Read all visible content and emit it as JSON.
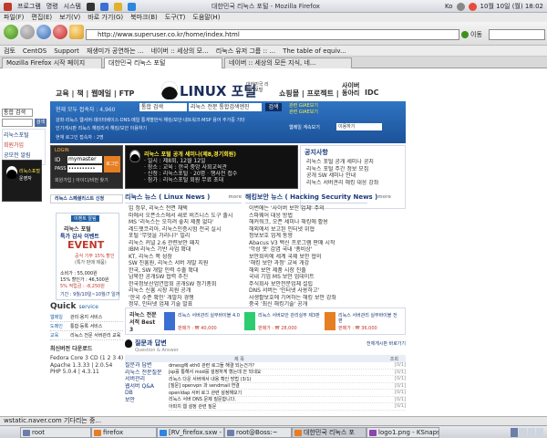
{
  "top_panel": {
    "menus": [
      "프로그램",
      "명령",
      "시스템"
    ],
    "window_title": "대한민국 리눅스 포털 - Mozilla Firefox",
    "kbd": "Ko",
    "clock": "10월 10일 (월) 18:02"
  },
  "menubar": [
    "파일(F)",
    "편집(E)",
    "보기(V)",
    "바로 가기(G)",
    "북마크(B)",
    "도구(T)",
    "도움말(H)"
  ],
  "toolbar": {
    "url": "http://www.superuser.co.kr/home/index.html",
    "go_label": "이동"
  },
  "bookmarks": [
    "검토",
    "CentOS",
    "Support",
    "재생미가 공연하는 ...",
    "네이버 :: 세상의 모...",
    "리눅스 유저 그룹 :: ...",
    "The table of equiv..."
  ],
  "tabs": [
    "Mozilla Firefox 시작 페이지",
    "대한민국 리눅스 포털",
    "네이버 :: 세상의 모든 지식, 네..."
  ],
  "status": "wstatic.naver.com 기다리는 중...",
  "taskbar": [
    "root",
    "firefox",
    "[RV_firefox.sxw - Op",
    "root@Boss:~",
    "대한민국 리눅스 포",
    "logo1.png - KSnaps"
  ],
  "left_col": {
    "search_label": "통합 검색",
    "search_btn": "검색",
    "promo": [
      "리눅스포털",
      "회원가입",
      "공모전 알림"
    ],
    "promo2": [
      "리눅스포털",
      "운영자"
    ]
  },
  "page": {
    "nav_left": "교육 | 책 | 웹메일 | FTP",
    "logo_main": "LINUX 포털",
    "logo_sub": "대한민국 리눅스포털",
    "nav_right": [
      "쇼핑몰 | 프로젝트 |",
      "사이버",
      "동아리",
      "IDC"
    ],
    "search_info": [
      "현재 모두 접속자 : 4,960",
      "현재 로그인 접속자 : 2명"
    ],
    "search_select": "통합 검색",
    "search_input": "리눅스 전문 통합검색엔진",
    "search_btn": "검색",
    "quick_links": [
      "관련 GIAE보기",
      "관련 GIAE보기"
    ],
    "banner_text": "강좌·리눅스 웹서버·데이터베이스·DNS·메일 통계별번식·해킹/보안·네트워크·MSP 용어 추가중 기타",
    "banner_text2": "인기게시판 리눅스 해킹리서 해킹/보안 이용하기",
    "sub_link": "웹메일 계속보기",
    "sub_select": "이용하기",
    "login": {
      "title": "LOGIN",
      "id_label": "ID",
      "id_value": "mymaster",
      "pw_label": "PASS",
      "pw_value": "••••••••••",
      "btn": "로그인",
      "links": "회원가입 | 아이디/비번 찾기"
    },
    "seminar": {
      "title": "리눅스 포털 공개 세미나(제8,경기회원)",
      "lines": [
        "· 일시 : 제8회, 12월 12일",
        "· 장소 : 교육 : 한국 중앙 사회교육관",
        "· 신청 : 리눅스포털 · 20명 · 행사전 접수",
        "· 참가 : 리눅스포털 회원 무료 초대"
      ]
    },
    "notice": {
      "title": "공지사항",
      "items": [
        "리눅스 포털 공개 세미나 공지",
        "리눅스 포털 주간 정보 모집",
        "공개 SW 세미나 안내",
        "리눅스 서버관리 해킹 대응 강좌"
      ]
    },
    "special": "리눅스 스페셜리스트 신청",
    "linux_news": {
      "title": "리눅스 뉴스 ( Linux News )",
      "more": "more",
      "items": [
        "입 정부, 리눅스 전면 채택",
        "마에서 오픈소스에서 새로 비즈니스 도구 출시",
        "MS '리눅스는 오히려 좋지 제품 없다'",
        "레드햇코리아, 리눅스인증시험 전국 실시",
        "포털 '무엇을 가리나?' 빌리",
        "리눅스 커널 2.6 관련보안 패치",
        "IBM 리눅스 기반 사업 확대",
        "KT, 리눅스 쪽 성장",
        "SW 진흥원, 리눅스 서버 개발 지원",
        "한국, SW 개발 인력 수출 확대",
        "남북한 공개SW 협력 추진",
        "한국정보산업연합회 공개SW 정기총회",
        "리눅스 신흥 시장 지원 공개",
        "'한국 수준 확인' 개발자 경쟁",
        "정부, 인터넷 업체 기술 발표"
      ]
    },
    "security_news": {
      "title": "해킹보안 뉴스 ( Hacking Security News )",
      "more": "more",
      "items": [
        "이번에는 '사이버 보안 업체' 주의",
        "스파웨어 대응 방법",
        "해커워크, 오픈 세미나 해킹에 활용",
        "해외에서 보고된 인터넷 위협",
        "정보보호 업계 동향",
        "Abacus V3 백신 프로그램 판매 시작",
        "'악성 봇' 감염 국내 '총비상'",
        "보안회의에 세계 국제 보안 협의",
        "'해킹 보안 과정' 교육 개강",
        "해외 보안 제품 시장 진출",
        "국내 기업 MS 보안 업데이트",
        "주식회사 보안전문업체 설립",
        "DNS 서버는 '인터넷 사용하고'",
        "사생활보호에 기여하는 해킹 보안 강좌",
        "중국 '최신 해킹기술' 공개"
      ]
    },
    "event": {
      "badge": "이벤트 알림",
      "title1": "리눅스 포털",
      "title2": "특가 감사 이벤트",
      "title3": "EVENT",
      "line1": "공식 기부 15% 할인",
      "line2": "(특가 판매 제품)",
      "price1": "소비가 : 55,000원",
      "price2": "15% 할인가 : 46,500원",
      "price3": "5% 적립금 : -8,250원",
      "period": "기간 : 9월/10일~10월/7 일까"
    },
    "books": {
      "title": "리눅스 전문서적 Best 3",
      "items": [
        {
          "name": "리눅스 서버관리 실무바이블 4.0",
          "price": "판매가 : ₩ 40,000"
        },
        {
          "name": "리눅스 서버보안 관리실무 제3판",
          "price": "판매가 : ₩ 28,000"
        },
        {
          "name": "리눅스 서버관리 실무바이블 전편",
          "price": "판매가 : ₩ 36,000"
        }
      ]
    },
    "quick_service": {
      "title": "Quick",
      "title2": "service",
      "rows": [
        {
          "k": "웹메일",
          "v": "관리·용지 서비스"
        },
        {
          "k": "도메인",
          "v": "통합·등록 서비스"
        },
        {
          "k": "교육",
          "v": "리눅스 전문 서버관리 교육"
        }
      ],
      "latest_title": "최신버전 다운로드",
      "latest_items": [
        "Fedora Core 3 CD (1 2 3 4)",
        "Apache 1.3.33 | 2.0.54",
        "PHP 5.0.4 | 4.3.11"
      ]
    },
    "qna": {
      "title": "질문과 답변",
      "sub": "Question & Answer",
      "more": "전체게시판 바로가기",
      "cols": [
        "제 목",
        "조회"
      ],
      "cats": [
        "질문과 답변",
        "리눅스 전문질문",
        "서버관리",
        "웹서버 Q&A",
        "DB",
        "보안"
      ],
      "items": [
        {
          "t": "dmesg에 eth0 관련 로그들 해결 되는건가?",
          "c": "[0/1]"
        },
        {
          "t": "jsp를 통해서 mod를 설정하게 했는데 안 되네요",
          "c": "[0/1]"
        },
        {
          "t": "리눅스 다운 서버에서 내용 확인 방법 (3/1)",
          "c": "[0/1]"
        },
        {
          "t": "[질문] openvpn 과 sendmail 연결",
          "c": "[0/1]"
        },
        {
          "t": "openldap 서버 로그 관련 설정해보기",
          "c": "[0/1]"
        },
        {
          "t": "리눅스 서버 DNS 문제 질문합니다.",
          "c": "[0/1]"
        },
        {
          "t": "아파치 웹 설정 관련 질문",
          "c": "[0/1]"
        }
      ]
    }
  }
}
